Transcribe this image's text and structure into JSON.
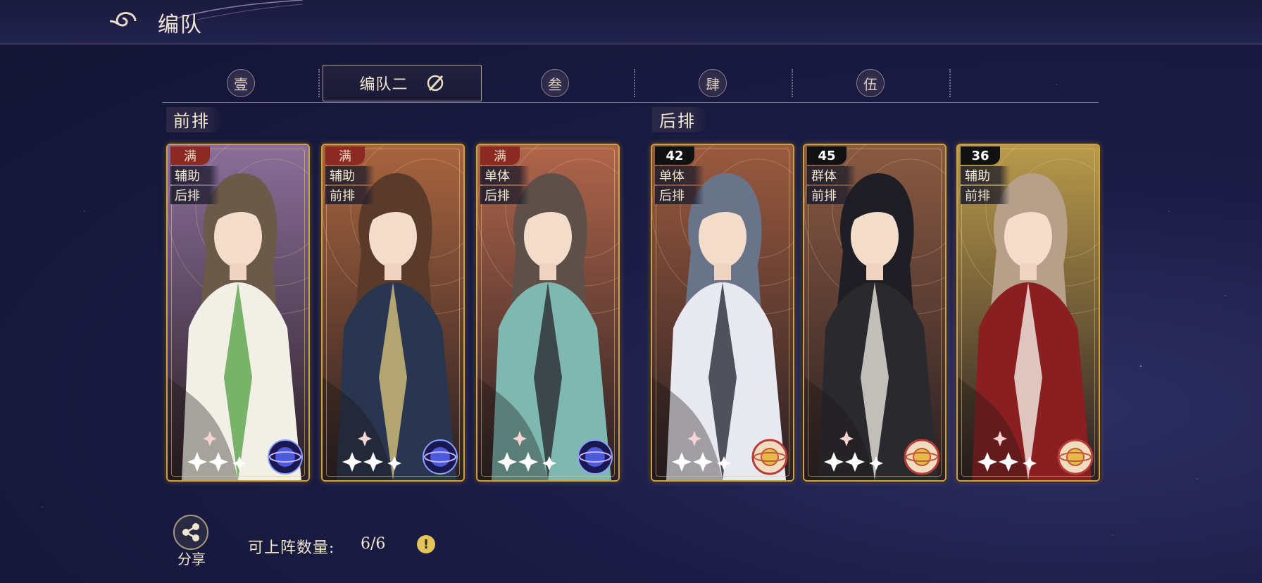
{
  "header": {
    "title": "编队"
  },
  "tabs": [
    {
      "label": "壹"
    },
    {
      "label": "编队二",
      "active": true
    },
    {
      "label": "叁"
    },
    {
      "label": "肆"
    },
    {
      "label": "伍"
    }
  ],
  "rows": {
    "front_label": "前排",
    "back_label": "后排"
  },
  "cards": [
    {
      "badge": "满",
      "tag1": "辅助",
      "tag2": "后排",
      "tone": "#8a6e9a",
      "hair": "#6b5a4a",
      "robe": "#f2efe6",
      "accent": "#5aa34a",
      "orb": "violet"
    },
    {
      "badge": "满",
      "tag1": "辅助",
      "tag2": "前排",
      "tone": "#a8643e",
      "hair": "#5a3a2a",
      "robe": "#2a3550",
      "accent": "#d6c27a",
      "orb": "violet"
    },
    {
      "badge": "满",
      "tag1": "单体",
      "tag2": "后排",
      "tone": "#b0654a",
      "hair": "#5e5048",
      "robe": "#7fb8b0",
      "accent": "#2a2a2e",
      "orb": "violet"
    },
    {
      "badge": "42",
      "tag1": "单体",
      "tag2": "后排",
      "tone": "#9a5a3e",
      "hair": "#6a7488",
      "robe": "#e8e8f0",
      "accent": "#2a2a3a",
      "orb": "gold"
    },
    {
      "badge": "45",
      "tag1": "群体",
      "tag2": "前排",
      "tone": "#8a5a42",
      "hair": "#1e1e24",
      "robe": "#2a2a2e",
      "accent": "#e8e4dc",
      "orb": "gold"
    },
    {
      "badge": "36",
      "tag1": "辅助",
      "tag2": "前排",
      "tone": "#b89a4a",
      "hair": "#b7a08a",
      "robe": "#8a1f22",
      "accent": "#f4efe6",
      "orb": "gold"
    }
  ],
  "footer": {
    "share_label": "分享",
    "count_label": "可上阵数量:",
    "count_value": "6/6"
  }
}
